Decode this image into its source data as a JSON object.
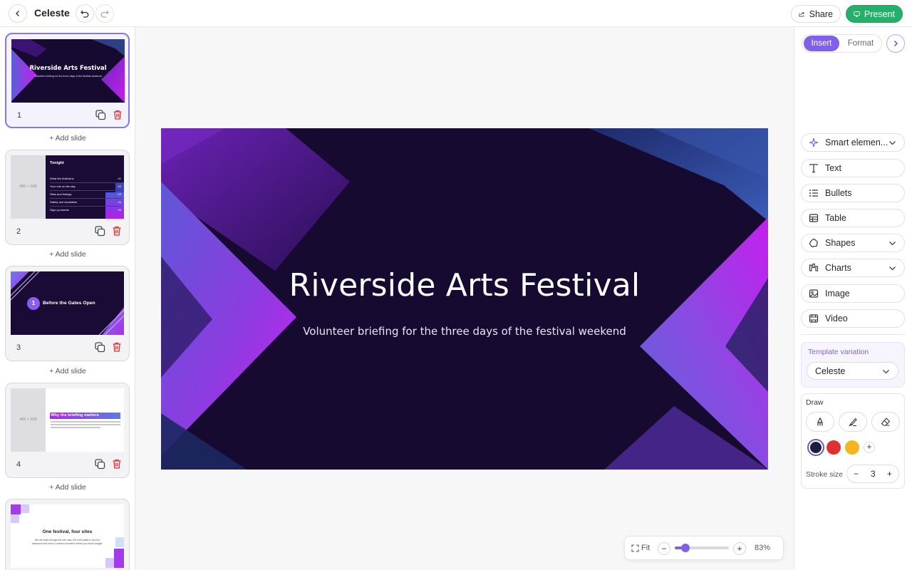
{
  "app": {
    "doc_title": "Celeste",
    "share_label": "Share",
    "present_label": "Present",
    "accent_color": "#8060e8",
    "present_color": "#25b06a"
  },
  "sidebar": {
    "add_slide_label": "+ Add slide",
    "slides": [
      {
        "number": "1",
        "title": "Riverside Arts Festival",
        "subtitle": "Volunteer briefing for the three days of the festival weekend"
      },
      {
        "number": "2",
        "placeholder": "400 × 900",
        "title": "Tonight",
        "agenda": [
          {
            "label": "What the festival is",
            "num": "01"
          },
          {
            "label": "Your role on the day",
            "num": "02"
          },
          {
            "label": "Sites and timings",
            "num": "03"
          },
          {
            "label": "Safety and escalation",
            "num": "04"
          },
          {
            "label": "Sign-up sheets",
            "num": "05"
          }
        ]
      },
      {
        "number": "3",
        "badge": "1",
        "title": "Before the Gates Open"
      },
      {
        "number": "4",
        "placeholder": "400 × 900",
        "title": "Why the briefing matters"
      },
      {
        "title": "One festival, four sites",
        "body": "We will walk through the site map, the shift pattern, and the decisions that need a named volunteer before you leave tonight."
      }
    ]
  },
  "canvas": {
    "title": "Riverside Arts Festival",
    "subtitle": "Volunteer briefing for the three days of the festival weekend"
  },
  "zoom": {
    "fit_label": "Fit",
    "level": "83%",
    "value": 0.2
  },
  "panel": {
    "tabs": [
      "Insert",
      "Format"
    ],
    "tools": [
      {
        "label": "Smart elemen...",
        "icon": "sparkle-icon",
        "dropdown": true
      },
      {
        "label": "Text",
        "icon": "text-icon",
        "dropdown": false
      },
      {
        "label": "Bullets",
        "icon": "bullets-icon",
        "dropdown": false
      },
      {
        "label": "Table",
        "icon": "table-icon",
        "dropdown": false
      },
      {
        "label": "Shapes",
        "icon": "shapes-icon",
        "dropdown": true
      },
      {
        "label": "Charts",
        "icon": "charts-icon",
        "dropdown": true
      },
      {
        "label": "Image",
        "icon": "image-icon",
        "dropdown": false
      },
      {
        "label": "Video",
        "icon": "video-icon",
        "dropdown": false
      }
    ],
    "template_variation_label": "Template variation",
    "template_variation_value": "Celeste",
    "draw_label": "Draw",
    "colors": [
      "#1b1f3b",
      "#e03131",
      "#f5b520"
    ],
    "stroke_label": "Stroke size",
    "stroke_value": "3"
  }
}
